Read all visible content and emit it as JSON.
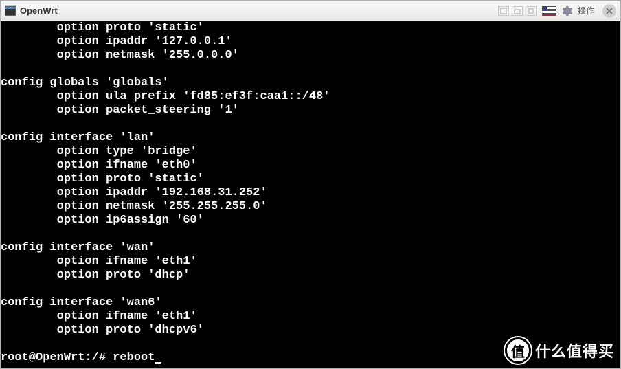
{
  "titlebar": {
    "title": "OpenWrt",
    "action_label": "操作"
  },
  "terminal": {
    "lines": [
      "        option proto 'static'",
      "        option ipaddr '127.0.0.1'",
      "        option netmask '255.0.0.0'",
      "",
      "config globals 'globals'",
      "        option ula_prefix 'fd85:ef3f:caa1::/48'",
      "        option packet_steering '1'",
      "",
      "config interface 'lan'",
      "        option type 'bridge'",
      "        option ifname 'eth0'",
      "        option proto 'static'",
      "        option ipaddr '192.168.31.252'",
      "        option netmask '255.255.255.0'",
      "        option ip6assign '60'",
      "",
      "config interface 'wan'",
      "        option ifname 'eth1'",
      "        option proto 'dhcp'",
      "",
      "config interface 'wan6'",
      "        option ifname 'eth1'",
      "        option proto 'dhcpv6'",
      ""
    ],
    "prompt": "root@OpenWrt:/# ",
    "command": "reboot"
  },
  "watermark": {
    "badge": "值",
    "text": "什么值得买"
  }
}
